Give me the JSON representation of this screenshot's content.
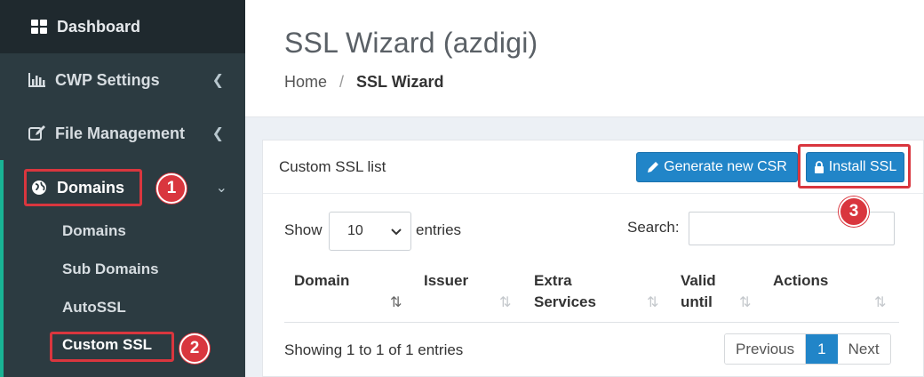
{
  "sidebar": {
    "dashboard": "Dashboard",
    "cwp_settings": "CWP Settings",
    "file_management": "File Management",
    "domains": "Domains",
    "sub_items": [
      "Domains",
      "Sub Domains",
      "AutoSSL",
      "Custom SSL"
    ]
  },
  "header": {
    "title": "SSL Wizard (azdigi)",
    "breadcrumb_home": "Home",
    "breadcrumb_sep": "/",
    "breadcrumb_active": "SSL Wizard"
  },
  "card": {
    "title": "Custom SSL list",
    "generate_button": "Generate new CSR",
    "install_button": "Install SSL",
    "show_label": "Show",
    "page_size": "10",
    "entries_label": "entries",
    "search_label": "Search:",
    "columns": [
      "Domain",
      "Issuer",
      "Extra",
      "Services",
      "Valid",
      "until",
      "Actions"
    ],
    "info": "Showing 1 to 1 of 1 entries",
    "pager": {
      "previous": "Previous",
      "current": "1",
      "next": "Next"
    }
  },
  "annotations": {
    "step1": "1",
    "step2": "2",
    "step3": "3"
  },
  "colors": {
    "sidebar": "#222d32",
    "accent": "#19b394",
    "primary": "#2185c8",
    "highlight": "#d9363e"
  }
}
